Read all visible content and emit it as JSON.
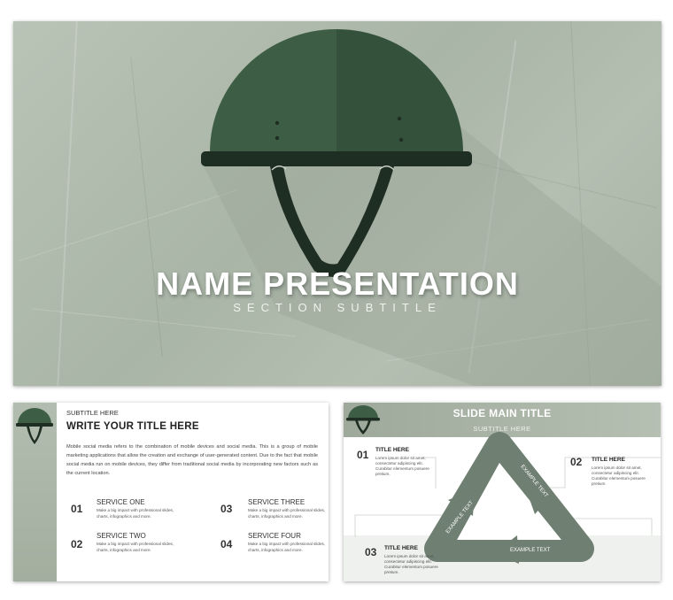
{
  "main_slide": {
    "title": "NAME PRESENTATION",
    "subtitle": "SECTION SUBTITLE",
    "icon": "army-helmet-icon"
  },
  "slide_2": {
    "subtitle": "SUBTITLE HERE",
    "title": "WRITE YOUR TITLE HERE",
    "body": "Mobile social media refers to the combination of mobile devices and social media. This is a group of mobile marketing applications that allow the creation and exchange of user-generated content. Due to the fact that mobile social media run on mobile devices, they differ from traditional social media by incorporating new factors such as the current location.",
    "services": [
      {
        "num": "01",
        "title": "SERVICE ONE",
        "desc": "Make a big impact with professional slides, charts, infographics and more."
      },
      {
        "num": "02",
        "title": "SERVICE TWO",
        "desc": "Make a big impact with professional slides, charts, infographics and more."
      },
      {
        "num": "03",
        "title": "SERVICE THREE",
        "desc": "Make a big impact with professional slides, charts, infographics and more."
      },
      {
        "num": "04",
        "title": "SERVICE FOUR",
        "desc": "Make a big impact with professional slides, charts, infographics and more."
      }
    ]
  },
  "slide_3": {
    "title": "SLIDE MAIN TITLE",
    "subtitle": "SUBTITLE HERE",
    "items": [
      {
        "num": "01",
        "label": "TITLE HERE",
        "desc": "Lorem ipsum dolor sit amet, consectetur adipiscing elit. Curabitur elementum posuere pretium."
      },
      {
        "num": "02",
        "label": "TITLE HERE",
        "desc": "Lorem ipsum dolor sit amet, consectetur adipiscing elit. Curabitur elementum posuere pretium."
      },
      {
        "num": "03",
        "label": "TITLE HERE",
        "desc": "Lorem ipsum dolor sit amet, consectetur adipiscing elit. Curabitur elementum posuere pretium."
      }
    ],
    "cycle_labels": [
      "EXAMPLE TEXT",
      "EXAMPLE TEXT",
      "EXAMPLE TEXT"
    ]
  },
  "colors": {
    "helmet_green": "#3d5e44",
    "helmet_dark": "#1f2e22",
    "background_grey_green": "#aeb9ab",
    "triangle_grey": "#6f7f71"
  }
}
